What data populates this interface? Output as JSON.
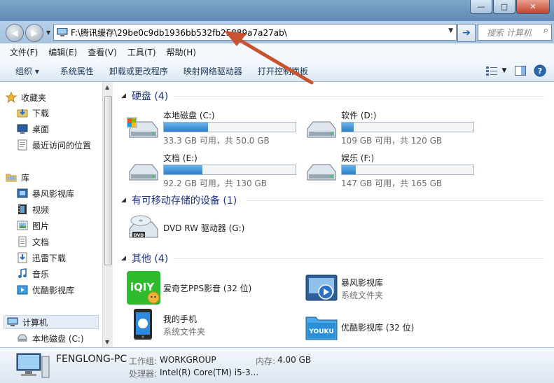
{
  "window": {
    "minimize_glyph": "—",
    "maximize_glyph": "□",
    "close_glyph": "✕"
  },
  "address": {
    "path": "F:\\腾讯缓存\\29be0c9db1936bb532fb25889a7a27ab\\",
    "search_placeholder": "搜索 计算机"
  },
  "menu": [
    "文件(F)",
    "编辑(E)",
    "查看(V)",
    "工具(T)",
    "帮助(H)"
  ],
  "commands": [
    "组织 ▾",
    "系统属性",
    "卸载或更改程序",
    "映射网络驱动器",
    "打开控制面板"
  ],
  "sidebar": {
    "favorites": {
      "label": "收藏夹",
      "items": [
        "下载",
        "桌面",
        "最近访问的位置"
      ]
    },
    "libraries": {
      "label": "库",
      "items": [
        "暴风影视库",
        "视频",
        "图片",
        "文档",
        "迅雷下载",
        "音乐",
        "优酷影视库"
      ]
    },
    "computer": {
      "label": "计算机",
      "items": [
        "本地磁盘 (C:)"
      ]
    }
  },
  "groups": {
    "hdd": "硬盘 (4)",
    "removable": "有可移动存储的设备 (1)",
    "other": "其他 (4)"
  },
  "drives": [
    {
      "name": "本地磁盘 (C:)",
      "free": "33.3 GB 可用，共 50.0 GB",
      "used_fraction": 0.334
    },
    {
      "name": "软件 (D:)",
      "free": "109 GB 可用，共 120 GB",
      "used_fraction": 0.092
    },
    {
      "name": "文档 (E:)",
      "free": "92.2 GB 可用，共 130 GB",
      "used_fraction": 0.291
    },
    {
      "name": "娱乐 (F:)",
      "free": "147 GB 可用，共 165 GB",
      "used_fraction": 0.109
    }
  ],
  "removable": [
    {
      "name": "DVD RW 驱动器 (G:)"
    }
  ],
  "other_items": [
    {
      "name": "爱奇艺PPS影音 (32 位)",
      "sub": ""
    },
    {
      "name": "暴风影视库",
      "sub": "系统文件夹"
    },
    {
      "name": "我的手机",
      "sub": "系统文件夹"
    },
    {
      "name": "优酷影视库 (32 位)",
      "sub": ""
    }
  ],
  "details": {
    "pc_name": "FENGLONG-PC",
    "workgroup_label": "工作组:",
    "workgroup_value": "WORKGROUP",
    "memory_label": "内存:",
    "memory_value": "4.00 GB",
    "cpu_label": "处理器:",
    "cpu_value": "Intel(R) Core(TM) i5-3..."
  },
  "colors": {
    "bar_fill": "#2b80c9",
    "group_header": "#1e3287",
    "arrow": "#c8532e"
  }
}
